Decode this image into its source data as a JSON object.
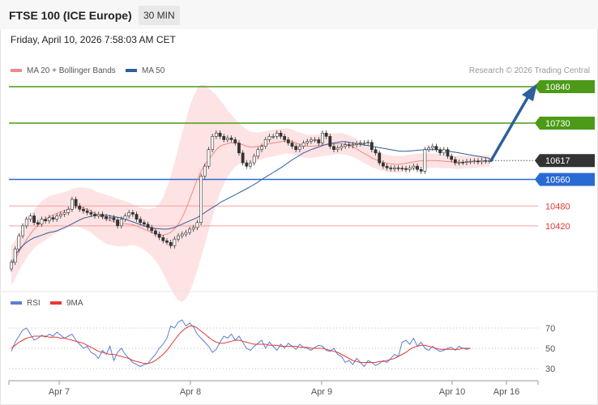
{
  "header": {
    "title": "FTSE 100 (ICE Europe)",
    "timeframe": "30 MIN",
    "datetime": "Friday, April 10, 2026 7:58:03 AM CET"
  },
  "legend": {
    "items": [
      {
        "label": "MA 20 + Bollinger Bands",
        "color": "#f08a8a"
      },
      {
        "label": "MA 50",
        "color": "#2e5f9c"
      }
    ],
    "credit": "Research © 2026 Trading Central"
  },
  "rsi_legend": {
    "items": [
      {
        "label": "RSI",
        "color": "#5b7fd6"
      },
      {
        "label": "9MA",
        "color": "#e53935"
      }
    ]
  },
  "chart_data": [
    {
      "type": "candlestick",
      "levels": [
        {
          "label": "10840",
          "value": 10840,
          "color": "#4c9a17",
          "style": "solid-tag"
        },
        {
          "label": "10730",
          "value": 10730,
          "color": "#4c9a17",
          "style": "solid-tag"
        },
        {
          "label": "10617",
          "value": 10617,
          "color": "#333333",
          "style": "dotted-tag"
        },
        {
          "label": "10560",
          "value": 10560,
          "color": "#2a6ad3",
          "style": "solid-tag"
        },
        {
          "label": "10480",
          "value": 10480,
          "color": "#e53935",
          "style": "text"
        },
        {
          "label": "10420",
          "value": 10420,
          "color": "#e53935",
          "style": "text"
        }
      ],
      "x_ticks": [
        "Apr 7",
        "Apr 8",
        "Apr 9",
        "Apr 10",
        "Apr 16"
      ],
      "close": [
        10310,
        10350,
        10390,
        10420,
        10440,
        10450,
        10430,
        10425,
        10440,
        10435,
        10445,
        10440,
        10450,
        10455,
        10460,
        10470,
        10500,
        10480,
        10470,
        10465,
        10460,
        10455,
        10450,
        10455,
        10448,
        10442,
        10445,
        10438,
        10420,
        10440,
        10450,
        10460,
        10455,
        10440,
        10430,
        10425,
        10415,
        10405,
        10395,
        10385,
        10375,
        10370,
        10360,
        10380,
        10390,
        10395,
        10400,
        10410,
        10415,
        10430,
        10570,
        10600,
        10650,
        10690,
        10700,
        10690,
        10680,
        10685,
        10680,
        10670,
        10640,
        10610,
        10600,
        10610,
        10630,
        10650,
        10660,
        10680,
        10690,
        10690,
        10700,
        10690,
        10680,
        10670,
        10660,
        10650,
        10660,
        10670,
        10675,
        10680,
        10680,
        10670,
        10700,
        10690,
        10660,
        10650,
        10655,
        10660,
        10665,
        10662,
        10665,
        10668,
        10670,
        10670,
        10672,
        10650,
        10640,
        10610,
        10600,
        10595,
        10592,
        10595,
        10594,
        10593,
        10590,
        10595,
        10600,
        10590,
        10585,
        10650,
        10655,
        10660,
        10650,
        10640,
        10650,
        10630,
        10620,
        10610,
        10612,
        10611,
        10614,
        10615,
        10616,
        10613,
        10617,
        10616,
        10617
      ],
      "ma50": [
        10300,
        10330,
        10348,
        10360,
        10370,
        10378,
        10384,
        10388,
        10392,
        10396,
        10400,
        10402,
        10405,
        10410,
        10415,
        10420,
        10426,
        10432,
        10438,
        10443,
        10446,
        10449,
        10451,
        10452,
        10452,
        10452,
        10450,
        10448,
        10446,
        10444,
        10440,
        10436,
        10432,
        10428,
        10424,
        10420,
        10417,
        10414,
        10412,
        10411,
        10410,
        10410,
        10412,
        10415,
        10420,
        10425,
        10430,
        10435,
        10440,
        10445,
        10452,
        10460,
        10468,
        10475,
        10482,
        10490,
        10496,
        10502,
        10508,
        10514,
        10520,
        10526,
        10532,
        10538,
        10545,
        10552,
        10560,
        10567,
        10574,
        10581,
        10588,
        10595,
        10603,
        10611,
        10619,
        10626,
        10633,
        10640,
        10645,
        10650,
        10654,
        10658,
        10662,
        10666,
        10668,
        10670,
        10672,
        10674,
        10674,
        10672,
        10670,
        10668,
        10666,
        10664,
        10662,
        10660,
        10658,
        10656,
        10654,
        10652,
        10650,
        10648,
        10646,
        10645,
        10645,
        10646,
        10647,
        10648,
        10649,
        10650,
        10650,
        10650,
        10650,
        10649,
        10648,
        10646,
        10644,
        10642,
        10640,
        10638,
        10636,
        10634,
        10632,
        10630,
        10628,
        10626,
        10624
      ],
      "ma20": [
        10300,
        10318,
        10340,
        10360,
        10378,
        10395,
        10410,
        10422,
        10432,
        10440,
        10447,
        10453,
        10458,
        10462,
        10466,
        10470,
        10474,
        10476,
        10476,
        10474,
        10470,
        10465,
        10458,
        10451,
        10445,
        10440,
        10436,
        10433,
        10430,
        10428,
        10426,
        10425,
        10424,
        10420,
        10415,
        10410,
        10405,
        10400,
        10395,
        10393,
        10392,
        10395,
        10400,
        10410,
        10425,
        10445,
        10470,
        10500,
        10530,
        10560,
        10585,
        10605,
        10620,
        10635,
        10650,
        10660,
        10665,
        10668,
        10670,
        10670,
        10668,
        10665,
        10660,
        10658,
        10658,
        10660,
        10662,
        10665,
        10668,
        10670,
        10672,
        10674,
        10676,
        10676,
        10674,
        10670,
        10666,
        10662,
        10660,
        10660,
        10661,
        10662,
        10664,
        10665,
        10666,
        10667,
        10668,
        10668,
        10666,
        10663,
        10658,
        10652,
        10645,
        10638,
        10632,
        10625,
        10620,
        10616,
        10612,
        10609,
        10607,
        10606,
        10606,
        10607,
        10609,
        10611,
        10613,
        10615,
        10616,
        10617,
        10617,
        10617,
        10617,
        10616,
        10615,
        10614,
        10613,
        10612,
        10612,
        10612,
        10613,
        10613,
        10614,
        10614,
        10615,
        10615,
        10616
      ],
      "bb_width": [
        60,
        58,
        56,
        55,
        55,
        56,
        58,
        60,
        62,
        63,
        62,
        60,
        58,
        57,
        56,
        56,
        57,
        58,
        60,
        62,
        64,
        66,
        68,
        70,
        72,
        74,
        74,
        73,
        72,
        70,
        68,
        65,
        62,
        60,
        60,
        62,
        66,
        72,
        80,
        95,
        115,
        140,
        170,
        200,
        230,
        255,
        270,
        280,
        280,
        275,
        260,
        240,
        215,
        190,
        165,
        140,
        120,
        100,
        85,
        72,
        62,
        55,
        50,
        46,
        44,
        42,
        41,
        40,
        40,
        40,
        40,
        39,
        38,
        38,
        37,
        36,
        36,
        36,
        35,
        35,
        34,
        34,
        34,
        33,
        33,
        32,
        32,
        32,
        31,
        31,
        30,
        30,
        29,
        29,
        28,
        28,
        27,
        27,
        26,
        26,
        25,
        25,
        25,
        24,
        24,
        24,
        23,
        23,
        22,
        22,
        22,
        22,
        21,
        21,
        21,
        20,
        20,
        20,
        20,
        19,
        19,
        19,
        19,
        18,
        18,
        18,
        18
      ]
    },
    {
      "type": "line",
      "title": "RSI",
      "y_ticks": [
        70,
        50,
        30
      ],
      "ylim": [
        24,
        82
      ],
      "series": [
        {
          "name": "RSI",
          "values": [
            47,
            56,
            62,
            68,
            70,
            64,
            58,
            60,
            63,
            61,
            64,
            62,
            66,
            63,
            60,
            62,
            64,
            58,
            54,
            50,
            52,
            46,
            44,
            40,
            48,
            44,
            52,
            38,
            46,
            50,
            44,
            40,
            36,
            34,
            32,
            34,
            35,
            40,
            44,
            50,
            54,
            60,
            72,
            70,
            76,
            78,
            72,
            75,
            71,
            64,
            60,
            56,
            52,
            46,
            49,
            56,
            62,
            60,
            64,
            58,
            62,
            56,
            50,
            48,
            52,
            55,
            58,
            50,
            56,
            52,
            48,
            54,
            50,
            55,
            52,
            49,
            54,
            51,
            50,
            48,
            51,
            53,
            52,
            48,
            47,
            50,
            44,
            42,
            36,
            38,
            34,
            40,
            36,
            32,
            38,
            36,
            33,
            35,
            38,
            36,
            40,
            44,
            42,
            56,
            58,
            54,
            60,
            52,
            56,
            50,
            48,
            52,
            49,
            47,
            48,
            50,
            51,
            48,
            52,
            50,
            49,
            50
          ]
        },
        {
          "name": "9MA",
          "values": [
            50,
            53,
            56,
            58,
            60,
            61,
            62,
            62,
            62,
            62,
            61,
            61,
            61,
            60,
            60,
            59,
            58,
            57,
            56,
            55,
            53,
            51,
            49,
            47,
            46,
            45,
            44,
            44,
            43,
            42,
            41,
            40,
            38,
            37,
            36,
            35,
            35,
            36,
            38,
            41,
            44,
            48,
            53,
            58,
            63,
            67,
            70,
            72,
            72,
            70,
            67,
            64,
            61,
            58,
            56,
            55,
            55,
            56,
            57,
            58,
            58,
            57,
            56,
            55,
            54,
            54,
            54,
            54,
            53,
            53,
            53,
            52,
            52,
            52,
            52,
            52,
            51,
            51,
            51,
            50,
            50,
            50,
            50,
            49,
            48,
            47,
            46,
            44,
            42,
            40,
            38,
            37,
            36,
            36,
            36,
            36,
            36,
            37,
            37,
            38,
            39,
            40,
            42,
            44,
            46,
            49,
            51,
            52,
            53,
            53,
            52,
            51,
            50,
            49,
            49,
            49,
            49,
            49,
            49,
            50,
            50,
            50
          ]
        }
      ],
      "x_ticks": [
        "Apr 7",
        "Apr 8",
        "Apr 9",
        "Apr 10",
        "Apr 16"
      ]
    }
  ]
}
